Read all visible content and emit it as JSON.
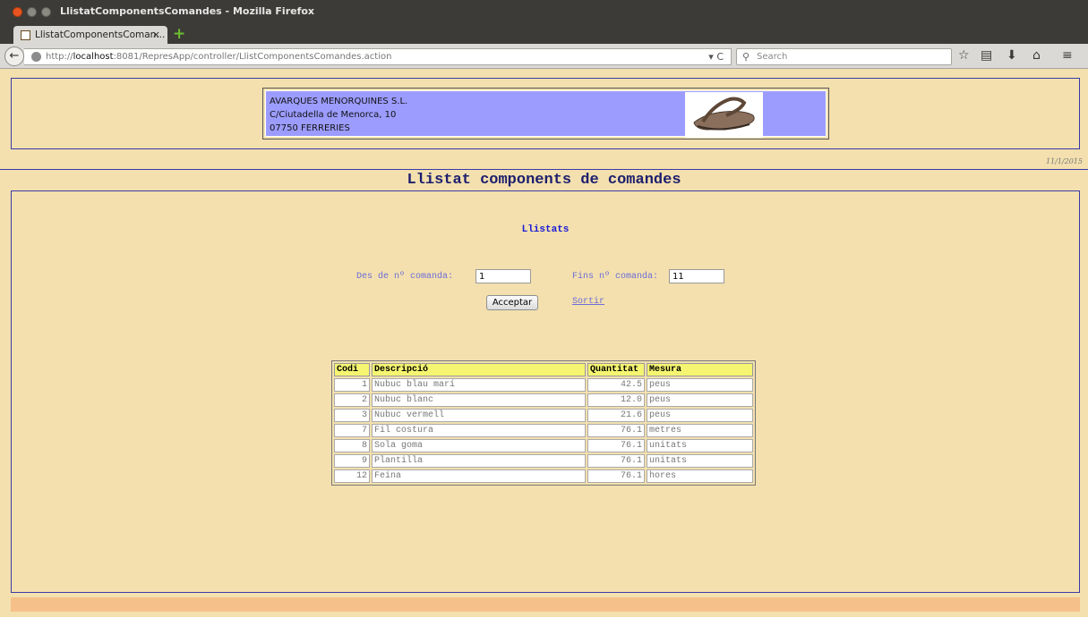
{
  "window": {
    "title": "LlistatComponentsComandes - Mozilla Firefox"
  },
  "tab": {
    "label": "LlistatComponentsComan...",
    "close": "×",
    "new_tab": "+"
  },
  "navbar": {
    "url_prefix": "http://",
    "url_host": "localhost",
    "url_path": ":8081/RepresApp/controller/LlistComponentsComandes.action",
    "reload": "▾ C",
    "search_placeholder": "Search"
  },
  "company": {
    "name": "AVARQUES MENORQUINES S.L.",
    "address": "C/Ciutadella de Menorca, 10",
    "city": "07750 FERRERIES"
  },
  "date": "11/1/2015",
  "page_title": "Llistat components de comandes",
  "form": {
    "heading": "Llistats",
    "from_label": "Des de nº comanda:",
    "from_value": "1",
    "to_label": "Fins nº comanda:",
    "to_value": "11",
    "accept_label": "Acceptar",
    "exit_label": "Sortir"
  },
  "table": {
    "headers": [
      "Codi",
      "Descripció",
      "Quantitat",
      "Mesura"
    ],
    "rows": [
      [
        "1",
        "Nubuc blau marí",
        "42.5",
        "peus"
      ],
      [
        "2",
        "Nubuc blanc",
        "12.0",
        "peus"
      ],
      [
        "3",
        "Nubuc vermell",
        "21.6",
        "peus"
      ],
      [
        "7",
        "Fil costura",
        "76.1",
        "metres"
      ],
      [
        "8",
        "Sola goma",
        "76.1",
        "unitats"
      ],
      [
        "9",
        "Plantilla",
        "76.1",
        "unitats"
      ],
      [
        "12",
        "Feina",
        "76.1",
        "hores"
      ]
    ]
  }
}
